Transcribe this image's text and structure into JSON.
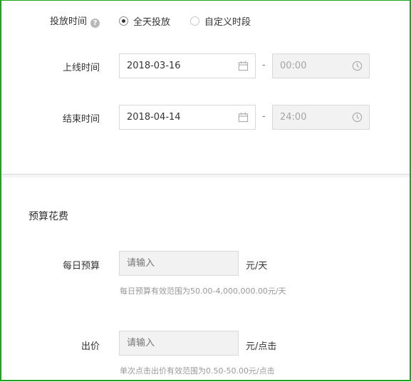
{
  "schedule": {
    "label": "投放时间",
    "options": [
      {
        "label": "全天投放",
        "checked": true
      },
      {
        "label": "自定义时段",
        "checked": false
      }
    ]
  },
  "online": {
    "label": "上线时间",
    "date": "2018-03-16",
    "time": "00:00"
  },
  "end": {
    "label": "结束时间",
    "date": "2018-04-14",
    "time": "24:00"
  },
  "dash": "-",
  "budget_section": {
    "title": "预算花费",
    "daily": {
      "label": "每日预算",
      "placeholder": "请输入",
      "unit": "元/天",
      "hint": "每日预算有效范围为50.00-4,000,000.00元/天"
    },
    "bid": {
      "label": "出价",
      "placeholder": "请输入",
      "unit": "元/点击",
      "hint": "单次点击出价有效范围为0.50-50.00元/点击"
    }
  },
  "colors": {
    "frame": "#1ea51e",
    "disabled_bg": "#f2f2f2",
    "hint": "#999999"
  }
}
